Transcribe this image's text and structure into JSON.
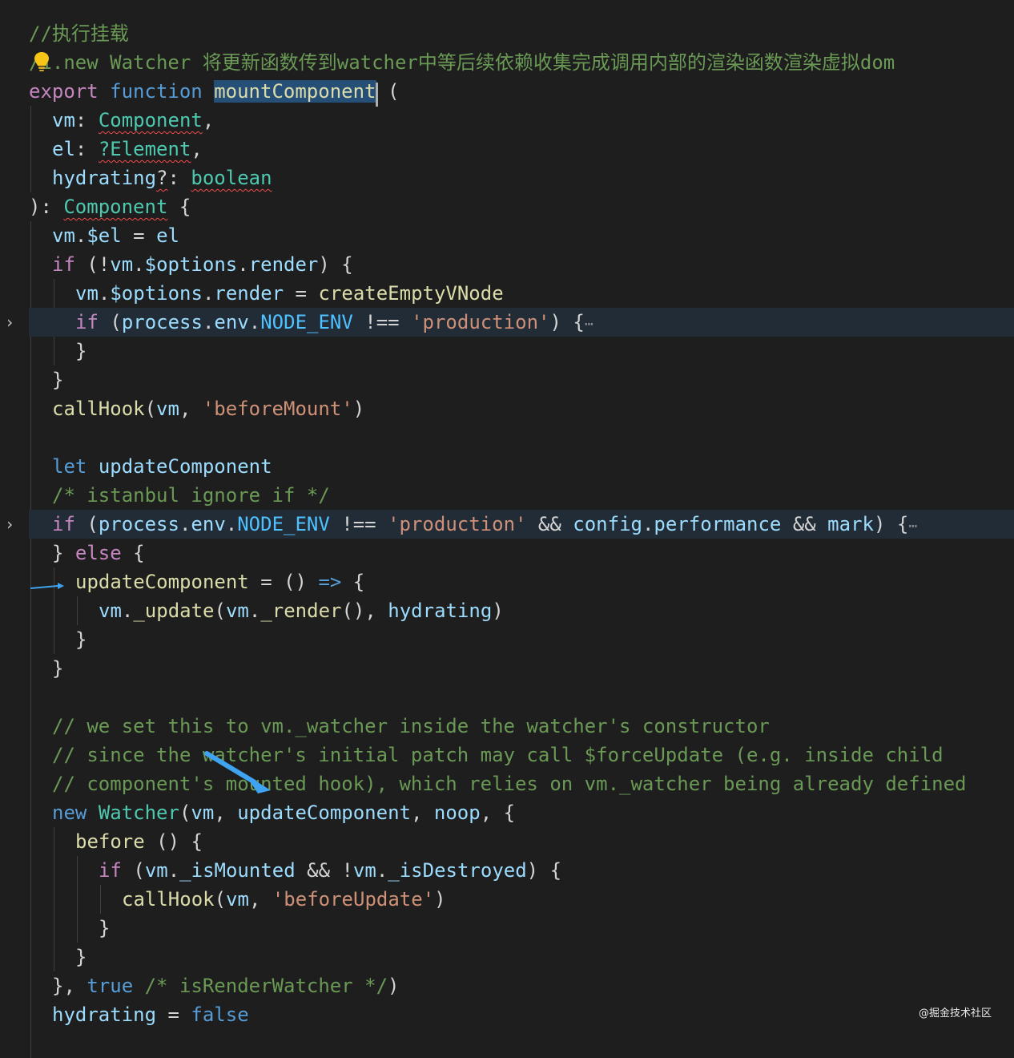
{
  "editor": {
    "language": "javascript",
    "colors": {
      "background": "#1e1e1e",
      "comment": "#6a9955",
      "keyword_control": "#c586c0",
      "keyword_storage": "#569cd6",
      "function": "#dcdcaa",
      "type": "#4ec9b0",
      "variable": "#9cdcfe",
      "constant": "#4fc1ff",
      "string": "#ce9178",
      "plain": "#d4d4d4",
      "selection": "#264f78",
      "line_highlight": "#222c37",
      "annotation_arrow": "#3fa3f0"
    },
    "icons": [
      "lightbulb-icon",
      "fold-chevron-icon",
      "annotation-arrow-icon"
    ],
    "lines": [
      {
        "indent": 0,
        "tokens": [
          [
            "//执行挂载",
            "#6a9955"
          ]
        ]
      },
      {
        "indent": 0,
        "bulb": true,
        "tokens": [
          [
            "/",
            "#6a9955"
          ],
          [
            "1.new Watcher 将更新函数传到watcher中等后续依赖收集完成调用内部的渲染函数渲染虚拟dom",
            "#6a9955"
          ]
        ]
      },
      {
        "indent": 0,
        "tokens": [
          [
            "export",
            "#c586c0"
          ],
          [
            " ",
            "#d4d4d4"
          ],
          [
            "function",
            "#569cd6"
          ],
          [
            " ",
            "#d4d4d4"
          ],
          [
            "mountComponent",
            "#dcdcaa",
            "sel"
          ],
          [
            " (",
            "#d4d4d4"
          ]
        ]
      },
      {
        "indent": 1,
        "tokens": [
          [
            "vm",
            "#9cdcfe"
          ],
          [
            ": ",
            "#d4d4d4"
          ],
          [
            "Component",
            "#4ec9b0",
            "sq"
          ],
          [
            ",",
            "#d4d4d4"
          ]
        ]
      },
      {
        "indent": 1,
        "tokens": [
          [
            "el",
            "#9cdcfe"
          ],
          [
            ": ",
            "#d4d4d4"
          ],
          [
            "?Element",
            "#4ec9b0",
            "sq"
          ],
          [
            ",",
            "#d4d4d4"
          ]
        ]
      },
      {
        "indent": 1,
        "tokens": [
          [
            "hydrating",
            "#9cdcfe"
          ],
          [
            "?",
            "#d4d4d4",
            "sq"
          ],
          [
            ": ",
            "#d4d4d4"
          ],
          [
            "boolean",
            "#4ec9b0",
            "sq"
          ]
        ]
      },
      {
        "indent": 0,
        "tokens": [
          [
            "): ",
            "#d4d4d4"
          ],
          [
            "Component",
            "#4ec9b0",
            "sq"
          ],
          [
            " {",
            "#d4d4d4"
          ]
        ]
      },
      {
        "indent": 1,
        "tokens": [
          [
            "vm",
            "#9cdcfe"
          ],
          [
            ".",
            "#d4d4d4"
          ],
          [
            "$el",
            "#9cdcfe"
          ],
          [
            " = ",
            "#d4d4d4"
          ],
          [
            "el",
            "#9cdcfe"
          ]
        ]
      },
      {
        "indent": 1,
        "tokens": [
          [
            "if",
            "#c586c0"
          ],
          [
            " (!",
            "#d4d4d4"
          ],
          [
            "vm",
            "#9cdcfe"
          ],
          [
            ".",
            "#d4d4d4"
          ],
          [
            "$options",
            "#9cdcfe"
          ],
          [
            ".",
            "#d4d4d4"
          ],
          [
            "render",
            "#9cdcfe"
          ],
          [
            ") {",
            "#d4d4d4"
          ]
        ]
      },
      {
        "indent": 2,
        "tokens": [
          [
            "vm",
            "#9cdcfe"
          ],
          [
            ".",
            "#d4d4d4"
          ],
          [
            "$options",
            "#9cdcfe"
          ],
          [
            ".",
            "#d4d4d4"
          ],
          [
            "render",
            "#9cdcfe"
          ],
          [
            " = ",
            "#d4d4d4"
          ],
          [
            "createEmptyVNode",
            "#dcdcaa"
          ]
        ]
      },
      {
        "indent": 2,
        "fold": true,
        "hl": true,
        "tokens": [
          [
            "if",
            "#c586c0"
          ],
          [
            " (",
            "#d4d4d4"
          ],
          [
            "process",
            "#9cdcfe"
          ],
          [
            ".",
            "#d4d4d4"
          ],
          [
            "env",
            "#9cdcfe"
          ],
          [
            ".",
            "#d4d4d4"
          ],
          [
            "NODE_ENV",
            "#4fc1ff"
          ],
          [
            " !== ",
            "#d4d4d4"
          ],
          [
            "'production'",
            "#ce9178"
          ],
          [
            ") {",
            "#d4d4d4"
          ],
          [
            "⋯",
            "#8c8c8c",
            "ell"
          ]
        ]
      },
      {
        "indent": 2,
        "tokens": [
          [
            "}",
            "#d4d4d4"
          ]
        ]
      },
      {
        "indent": 1,
        "tokens": [
          [
            "}",
            "#d4d4d4"
          ]
        ]
      },
      {
        "indent": 1,
        "tokens": [
          [
            "callHook",
            "#dcdcaa"
          ],
          [
            "(",
            "#d4d4d4"
          ],
          [
            "vm",
            "#9cdcfe"
          ],
          [
            ", ",
            "#d4d4d4"
          ],
          [
            "'beforeMount'",
            "#ce9178"
          ],
          [
            ")",
            "#d4d4d4"
          ]
        ]
      },
      {
        "indent": 1,
        "tokens": []
      },
      {
        "indent": 1,
        "tokens": [
          [
            "let",
            "#569cd6"
          ],
          [
            " ",
            "#d4d4d4"
          ],
          [
            "updateComponent",
            "#9cdcfe"
          ]
        ]
      },
      {
        "indent": 1,
        "tokens": [
          [
            "/* istanbul ignore if */",
            "#6a9955"
          ]
        ]
      },
      {
        "indent": 1,
        "fold": true,
        "hl": true,
        "tokens": [
          [
            "if",
            "#c586c0"
          ],
          [
            " (",
            "#d4d4d4"
          ],
          [
            "process",
            "#9cdcfe"
          ],
          [
            ".",
            "#d4d4d4"
          ],
          [
            "env",
            "#9cdcfe"
          ],
          [
            ".",
            "#d4d4d4"
          ],
          [
            "NODE_ENV",
            "#4fc1ff"
          ],
          [
            " !== ",
            "#d4d4d4"
          ],
          [
            "'production'",
            "#ce9178"
          ],
          [
            " && ",
            "#d4d4d4"
          ],
          [
            "config",
            "#9cdcfe"
          ],
          [
            ".",
            "#d4d4d4"
          ],
          [
            "performance",
            "#9cdcfe"
          ],
          [
            " && ",
            "#d4d4d4"
          ],
          [
            "mark",
            "#9cdcfe"
          ],
          [
            ") {",
            "#d4d4d4"
          ],
          [
            "⋯",
            "#8c8c8c",
            "ell"
          ]
        ]
      },
      {
        "indent": 1,
        "tokens": [
          [
            "} ",
            "#d4d4d4"
          ],
          [
            "else",
            "#c586c0"
          ],
          [
            " {",
            "#d4d4d4"
          ]
        ]
      },
      {
        "indent": 2,
        "tokens": [
          [
            "updateComponent",
            "#dcdcaa"
          ],
          [
            " = () ",
            "#d4d4d4"
          ],
          [
            "=>",
            "#569cd6"
          ],
          [
            " {",
            "#d4d4d4"
          ]
        ]
      },
      {
        "indent": 3,
        "tokens": [
          [
            "vm",
            "#9cdcfe"
          ],
          [
            ".",
            "#d4d4d4"
          ],
          [
            "_update",
            "#dcdcaa"
          ],
          [
            "(",
            "#d4d4d4"
          ],
          [
            "vm",
            "#9cdcfe"
          ],
          [
            ".",
            "#d4d4d4"
          ],
          [
            "_render",
            "#dcdcaa"
          ],
          [
            "(), ",
            "#d4d4d4"
          ],
          [
            "hydrating",
            "#9cdcfe"
          ],
          [
            ")",
            "#d4d4d4"
          ]
        ]
      },
      {
        "indent": 2,
        "tokens": [
          [
            "}",
            "#d4d4d4"
          ]
        ]
      },
      {
        "indent": 1,
        "tokens": [
          [
            "}",
            "#d4d4d4"
          ]
        ]
      },
      {
        "indent": 1,
        "tokens": []
      },
      {
        "indent": 1,
        "tokens": [
          [
            "// we set this to vm._watcher inside the watcher's constructor",
            "#6a9955"
          ]
        ]
      },
      {
        "indent": 1,
        "tokens": [
          [
            "// since the watcher's initial patch may call $forceUpdate (e.g. inside child",
            "#6a9955"
          ]
        ]
      },
      {
        "indent": 1,
        "tokens": [
          [
            "// component's mounted hook), which relies on vm._watcher being already defined",
            "#6a9955"
          ]
        ]
      },
      {
        "indent": 1,
        "tokens": [
          [
            "new",
            "#569cd6"
          ],
          [
            " ",
            "#d4d4d4"
          ],
          [
            "Watcher",
            "#4ec9b0"
          ],
          [
            "(",
            "#d4d4d4"
          ],
          [
            "vm",
            "#9cdcfe"
          ],
          [
            ", ",
            "#d4d4d4"
          ],
          [
            "updateComponent",
            "#9cdcfe"
          ],
          [
            ", ",
            "#d4d4d4"
          ],
          [
            "noop",
            "#9cdcfe"
          ],
          [
            ", {",
            "#d4d4d4"
          ]
        ]
      },
      {
        "indent": 2,
        "tokens": [
          [
            "before",
            "#dcdcaa"
          ],
          [
            " () {",
            "#d4d4d4"
          ]
        ]
      },
      {
        "indent": 3,
        "tokens": [
          [
            "if",
            "#c586c0"
          ],
          [
            " (",
            "#d4d4d4"
          ],
          [
            "vm",
            "#9cdcfe"
          ],
          [
            ".",
            "#d4d4d4"
          ],
          [
            "_isMounted",
            "#9cdcfe"
          ],
          [
            " && !",
            "#d4d4d4"
          ],
          [
            "vm",
            "#9cdcfe"
          ],
          [
            ".",
            "#d4d4d4"
          ],
          [
            "_isDestroyed",
            "#9cdcfe"
          ],
          [
            ") {",
            "#d4d4d4"
          ]
        ]
      },
      {
        "indent": 4,
        "tokens": [
          [
            "callHook",
            "#dcdcaa"
          ],
          [
            "(",
            "#d4d4d4"
          ],
          [
            "vm",
            "#9cdcfe"
          ],
          [
            ", ",
            "#d4d4d4"
          ],
          [
            "'beforeUpdate'",
            "#ce9178"
          ],
          [
            ")",
            "#d4d4d4"
          ]
        ]
      },
      {
        "indent": 3,
        "tokens": [
          [
            "}",
            "#d4d4d4"
          ]
        ]
      },
      {
        "indent": 2,
        "tokens": [
          [
            "}",
            "#d4d4d4"
          ]
        ]
      },
      {
        "indent": 1,
        "tokens": [
          [
            "}, ",
            "#d4d4d4"
          ],
          [
            "true",
            "#569cd6"
          ],
          [
            " ",
            "#d4d4d4"
          ],
          [
            "/* isRenderWatcher */",
            "#6a9955"
          ],
          [
            ")",
            "#d4d4d4"
          ]
        ]
      },
      {
        "indent": 1,
        "tokens": [
          [
            "hydrating",
            "#9cdcfe"
          ],
          [
            " = ",
            "#d4d4d4"
          ],
          [
            "false",
            "#569cd6"
          ]
        ]
      },
      {
        "indent": 1,
        "tokens": []
      }
    ]
  },
  "watermark": "@掘金技术社区"
}
